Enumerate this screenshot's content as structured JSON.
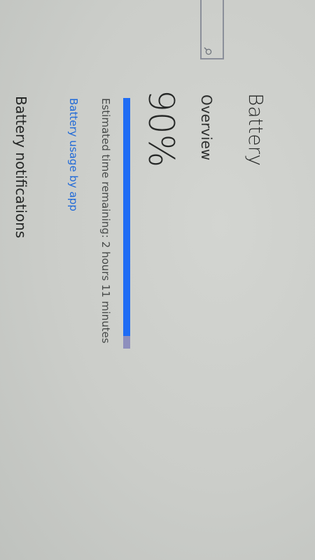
{
  "header": {
    "title": "Battery"
  },
  "search": {
    "icon": "search-icon"
  },
  "overview": {
    "title": "Overview",
    "percent_text": "90%",
    "charge_fraction": 0.95,
    "estimate_text": "Estimated time remaining: 2 hours 11 minutes",
    "usage_link": "Battery usage by app"
  },
  "notifications": {
    "title": "Battery notifications"
  },
  "colors": {
    "accent": "#1f6cf4",
    "track": "#8e8fbd",
    "link": "#1f69d8"
  }
}
